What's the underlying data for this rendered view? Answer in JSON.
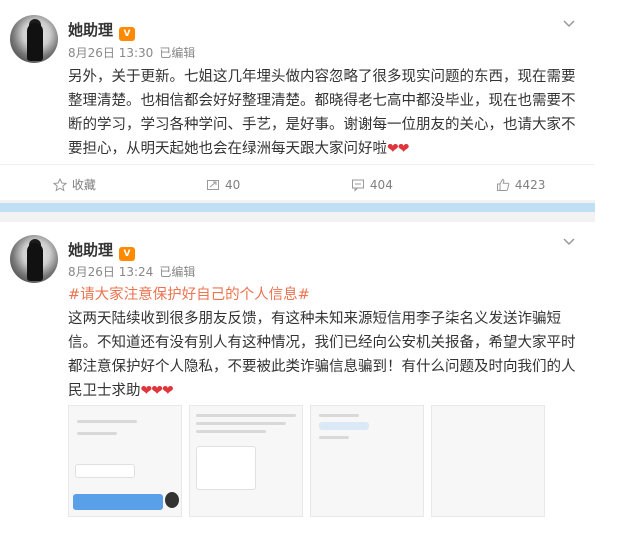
{
  "posts": [
    {
      "author": "她助理",
      "vip_badge": "V",
      "date": "8月26日 13:30",
      "edited": "已编辑",
      "text": "另外，关于更新。七姐这几年埋头做内容忽略了很多现实问题的东西，现在需要整理清楚。也相信都会好好整理清楚。都晓得老七高中都没毕业，现在也需要不断的学习，学习各种学问、手艺，是好事。谢谢每一位朋友的关心，也请大家不要担心，从明天起她也会在绿洲每天跟大家问好啦",
      "hearts": "❤❤",
      "actions": {
        "favorite": "收藏",
        "repost": "40",
        "comment": "404",
        "like": "4423"
      }
    },
    {
      "author": "她助理",
      "vip_badge": "V",
      "date": "8月26日 13:24",
      "edited": "已编辑",
      "topic": "#请大家注意保护好自己的个人信息#",
      "text": "这两天陆续收到很多朋友反馈，有这种未知来源短信用李子柒名义发送诈骗短信。不知道还有没有别人有这种情况，我们已经向公安机关报备，希望大家平时都注意保护好个人隐私，不要被此类诈骗信息骗到！有什么问题及时向我们的人民卫士求助",
      "hearts": "❤❤❤"
    }
  ],
  "icons": {
    "favorite": "star-icon",
    "repost": "repost-icon",
    "comment": "comment-icon",
    "like": "thumbs-up-icon",
    "more": "chevron-down-icon"
  },
  "colors": {
    "topic": "#eb7350",
    "heart": "#e0353b",
    "separator": "#bfe0f4",
    "vip": "#ff8a00"
  }
}
